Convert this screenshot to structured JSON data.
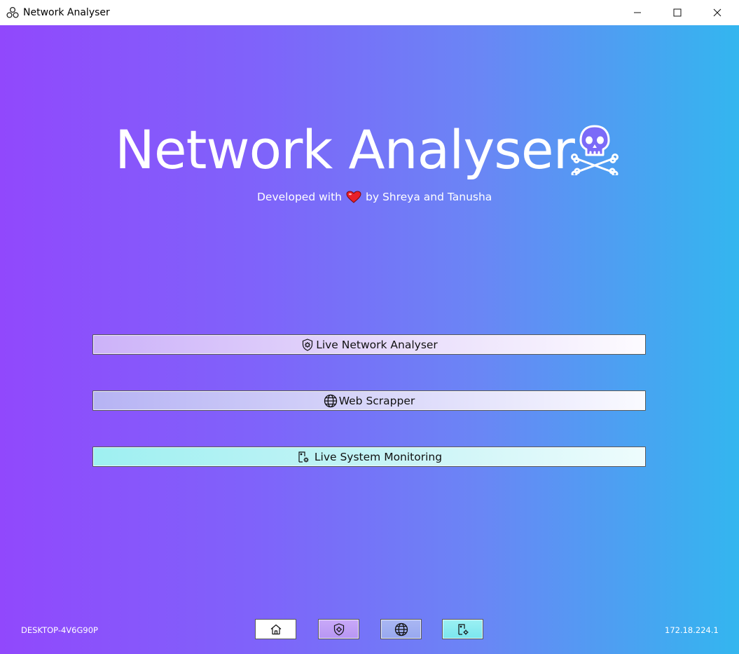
{
  "window": {
    "title": "Network Analyser",
    "controls": [
      "minimize",
      "maximize",
      "close"
    ]
  },
  "hero": {
    "title": "Network Analyser",
    "title_icon": "skull-crossbones-icon",
    "subtitle_prefix": "Developed with",
    "subtitle_icon": "heart-icon",
    "subtitle_suffix": "by Shreya and Tanusha"
  },
  "menu": {
    "buttons": [
      {
        "label": "Live Network Analyser",
        "icon": "shield-gear-icon"
      },
      {
        "label": "Web Scrapper",
        "icon": "globe-icon"
      },
      {
        "label": "Live System Monitoring",
        "icon": "server-gear-icon"
      }
    ]
  },
  "footer": {
    "hostname": "DESKTOP-4V6G90P",
    "ip": "172.18.224.1",
    "nav": [
      {
        "name": "home",
        "icon": "home-icon"
      },
      {
        "name": "live-network-analyser",
        "icon": "shield-gear-icon"
      },
      {
        "name": "web-scrapper",
        "icon": "globe-icon"
      },
      {
        "name": "live-system-monitoring",
        "icon": "server-gear-icon"
      }
    ]
  },
  "colors": {
    "gradient_start": "#9148fc",
    "gradient_end": "#33b6ef",
    "heart": "#e8202a",
    "text_on_gradient": "#ffffff"
  }
}
